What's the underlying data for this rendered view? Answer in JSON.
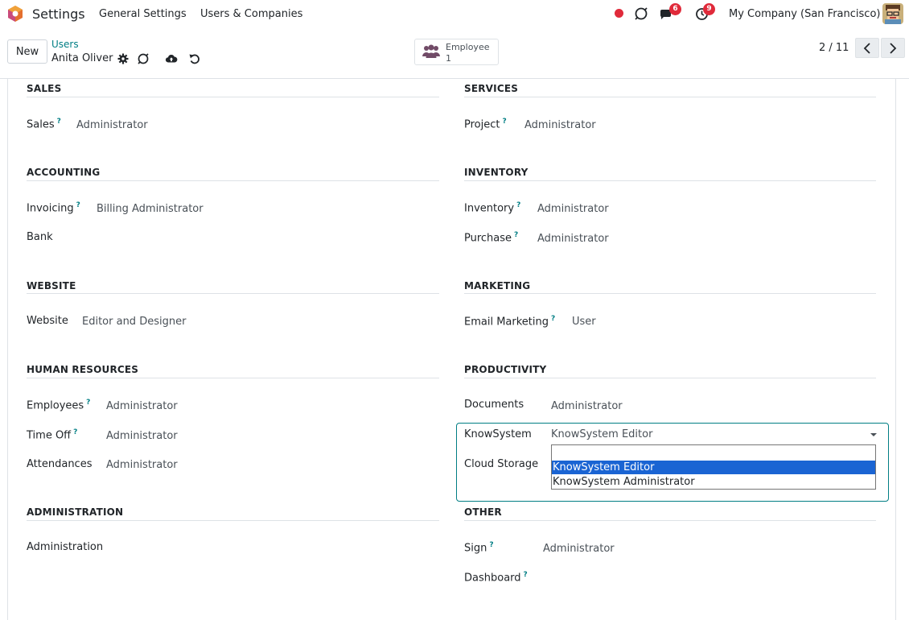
{
  "topbar": {
    "app_title": "Settings",
    "menu": [
      "General Settings",
      "Users & Companies"
    ],
    "chat_badge": "6",
    "activity_badge": "9",
    "company": "My Company (San Francisco)"
  },
  "controlbar": {
    "new_label": "New",
    "breadcrumb_parent": "Users",
    "breadcrumb_current": "Anita Oliver",
    "smart_button": {
      "label": "Employee",
      "value": "1"
    },
    "pager": "2 / 11"
  },
  "sections": {
    "sales": {
      "title": "SALES",
      "rows": [
        {
          "label": "Sales",
          "help": "?",
          "value": "Administrator"
        }
      ]
    },
    "services": {
      "title": "SERVICES",
      "rows": [
        {
          "label": "Project",
          "help": "?",
          "value": "Administrator"
        }
      ]
    },
    "accounting": {
      "title": "ACCOUNTING",
      "rows": [
        {
          "label": "Invoicing",
          "help": "?",
          "value": "Billing Administrator"
        },
        {
          "label": "Bank",
          "help": "",
          "value": ""
        }
      ]
    },
    "inventory": {
      "title": "INVENTORY",
      "rows": [
        {
          "label": "Inventory",
          "help": "?",
          "value": "Administrator"
        },
        {
          "label": "Purchase",
          "help": "?",
          "value": "Administrator"
        }
      ]
    },
    "website": {
      "title": "WEBSITE",
      "rows": [
        {
          "label": "Website",
          "help": "",
          "value": "Editor and Designer"
        }
      ]
    },
    "marketing": {
      "title": "MARKETING",
      "rows": [
        {
          "label": "Email Marketing",
          "help": "?",
          "value": "User"
        }
      ]
    },
    "hr": {
      "title": "HUMAN RESOURCES",
      "rows": [
        {
          "label": "Employees",
          "help": "?",
          "value": "Administrator"
        },
        {
          "label": "Time Off",
          "help": "?",
          "value": "Administrator"
        },
        {
          "label": "Attendances",
          "help": "",
          "value": "Administrator"
        }
      ]
    },
    "productivity": {
      "title": "PRODUCTIVITY",
      "rows": [
        {
          "label": "Documents",
          "help": "",
          "value": "Administrator"
        },
        {
          "label": "KnowSystem",
          "help": "",
          "value": "KnowSystem Editor"
        },
        {
          "label": "Cloud Storage",
          "help": "",
          "value": ""
        }
      ]
    },
    "administration": {
      "title": "ADMINISTRATION",
      "rows": [
        {
          "label": "Administration",
          "help": "",
          "value": ""
        }
      ]
    },
    "other": {
      "title": "OTHER",
      "rows": [
        {
          "label": "Sign",
          "help": "?",
          "value": "Administrator"
        },
        {
          "label": "Dashboard",
          "help": "?",
          "value": ""
        }
      ]
    }
  },
  "knowsystem_dropdown": {
    "options": [
      "",
      "KnowSystem Editor",
      "KnowSystem Administrator"
    ],
    "highlighted": "KnowSystem Editor"
  },
  "colors": {
    "accent": "#017e84",
    "badge": "#e02a3a",
    "selection": "#1a64d3",
    "brand": "#e46f2e"
  }
}
